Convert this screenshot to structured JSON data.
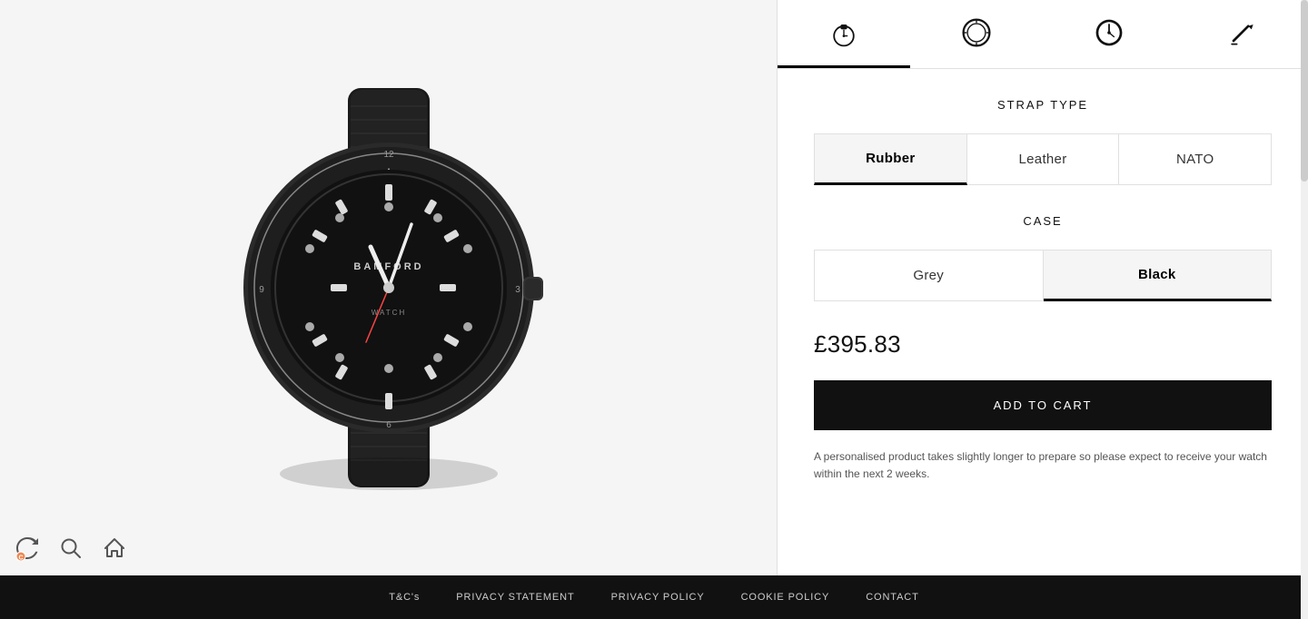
{
  "tabs": [
    {
      "id": "watch-face",
      "label": "Watch Face",
      "icon": "watch-icon",
      "active": true
    },
    {
      "id": "bezel",
      "label": "Bezel",
      "icon": "bezel-icon",
      "active": false
    },
    {
      "id": "clock",
      "label": "Clock",
      "icon": "clock-icon",
      "active": false
    },
    {
      "id": "engraving",
      "label": "Engraving",
      "icon": "engraving-icon",
      "active": false
    }
  ],
  "strap_section": {
    "title": "STRAP TYPE",
    "options": [
      {
        "id": "rubber",
        "label": "Rubber",
        "selected": true
      },
      {
        "id": "leather",
        "label": "Leather",
        "selected": false
      },
      {
        "id": "nato",
        "label": "NATO",
        "selected": false
      }
    ]
  },
  "case_section": {
    "title": "CASE",
    "options": [
      {
        "id": "grey",
        "label": "Grey",
        "selected": false
      },
      {
        "id": "black",
        "label": "Black",
        "selected": true
      }
    ]
  },
  "price": "£395.83",
  "add_to_cart_label": "ADD TO CART",
  "disclaimer": "A personalised product takes slightly longer to prepare so please expect to receive your watch within the next 2 weeks.",
  "footer": {
    "links": [
      {
        "id": "tcs",
        "label": "T&C's"
      },
      {
        "id": "privacy-statement",
        "label": "PRIVACY STATEMENT"
      },
      {
        "id": "privacy-policy",
        "label": "PRIVACY POLICY"
      },
      {
        "id": "cookie-policy",
        "label": "COOKIE POLICY"
      },
      {
        "id": "contact",
        "label": "CONTACT"
      }
    ]
  },
  "bottom_icons": [
    {
      "id": "refresh",
      "label": "Refresh"
    },
    {
      "id": "zoom",
      "label": "Zoom"
    },
    {
      "id": "home",
      "label": "Home"
    }
  ]
}
